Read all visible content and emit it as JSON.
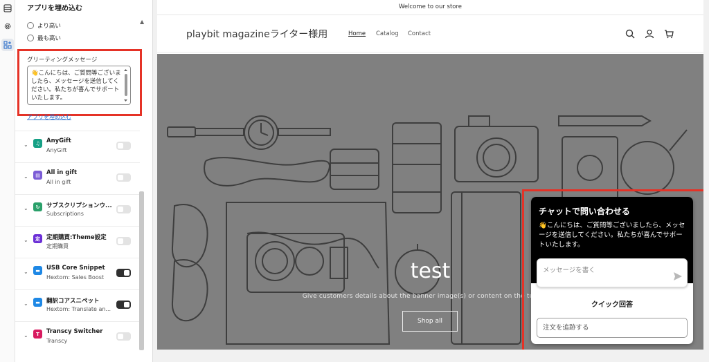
{
  "rail": {
    "items": [
      {
        "icon": "layout-sections-icon"
      },
      {
        "icon": "gear-icon"
      },
      {
        "icon": "apps-icon",
        "active": true
      }
    ]
  },
  "panel": {
    "title": "アプリを埋め込む",
    "radios": [
      {
        "label": "より高い"
      },
      {
        "label": "最も高い"
      }
    ],
    "greeting": {
      "label": "グリーティングメッセージ",
      "value": "👋こんにちは、ご質問等ございましたら、メッセージを送信してください。私たちが喜んでサポートいたします。"
    },
    "embed_link": "アプリを埋め込む",
    "apps": [
      {
        "name": "AnyGift",
        "sub": "AnyGift",
        "enabled": false,
        "icon_color": "#16a085"
      },
      {
        "name": "All in gift",
        "sub": "All in gift",
        "enabled": false,
        "icon_color": "#7b5cd6"
      },
      {
        "name": "サブスクリプションウ...",
        "sub": "Subscriptions",
        "enabled": false,
        "icon_color": "#2aa06a"
      },
      {
        "name": "定期購買:Theme設定",
        "sub": "定期購買",
        "enabled": false,
        "icon_color": "#6b2fd6"
      },
      {
        "name": "USB Core Snippet",
        "sub": "Hextom: Sales Boost",
        "enabled": true,
        "icon_color": "#1e88e5"
      },
      {
        "name": "翻訳コアスニペット",
        "sub": "Hextom: Translate an...",
        "enabled": true,
        "icon_color": "#1e88e5"
      },
      {
        "name": "Transcy Switcher",
        "sub": "Transcy",
        "enabled": false,
        "icon_color": "#d81b60"
      }
    ]
  },
  "store": {
    "announcement": "Welcome to our store",
    "name": "playbit magazineライター様用",
    "nav": [
      "Home",
      "Catalog",
      "Contact"
    ],
    "hero": {
      "title": "test",
      "subtitle": "Give customers details about the banner image(s) or content on the template.",
      "button": "Shop all"
    }
  },
  "chat": {
    "title": "チャットで問い合わせる",
    "message": "👋こんにちは、ご質問等ございましたら、メッセージを送信してください。私たちが喜んでサポートいたします。",
    "input_placeholder": "メッセージを書く",
    "quick_reply_label": "クイック回答",
    "track_order": "注文を追跡する"
  },
  "colors": {
    "highlight": "#e53226",
    "toggle_on": "#303030",
    "hero_bg": "#808080",
    "link": "#2c6ecb"
  }
}
